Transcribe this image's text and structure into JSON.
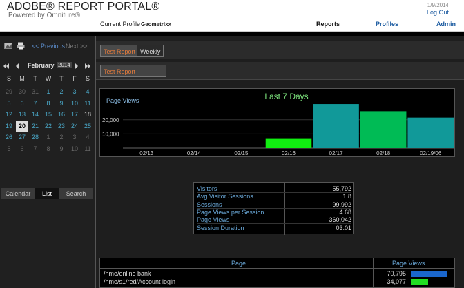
{
  "header": {
    "logo_title": "ADOBE® REPORT PORTAL®",
    "logo_subtitle": "Powered by Omniture®",
    "profile_label": "Current Profile",
    "profile_value": "Geometrixx",
    "date": "1/9/2014",
    "logout": "Log Out",
    "nav": [
      "Reports",
      "Profiles",
      "Admin"
    ]
  },
  "sidebar": {
    "prev": "<< Previous",
    "next": "Next >>",
    "month": "February",
    "year": "2014",
    "dow": [
      "S",
      "M",
      "T",
      "W",
      "T",
      "F",
      "S"
    ],
    "weeks": [
      [
        "29",
        "30",
        "31",
        "1",
        "2",
        "3",
        "4"
      ],
      [
        "5",
        "6",
        "7",
        "8",
        "9",
        "10",
        "11"
      ],
      [
        "12",
        "13",
        "14",
        "15",
        "16",
        "17",
        "18"
      ],
      [
        "19",
        "20",
        "21",
        "22",
        "23",
        "24",
        "25"
      ],
      [
        "26",
        "27",
        "28",
        "1",
        "2",
        "3",
        "4"
      ],
      [
        "5",
        "6",
        "7",
        "8",
        "9",
        "10",
        "11"
      ]
    ],
    "selected_day": "20",
    "tabs": [
      "Calendar",
      "List",
      "Search"
    ],
    "active_tab": "List"
  },
  "content": {
    "tabs": [
      "Test Report",
      "Weekly"
    ],
    "badge": "Test Report"
  },
  "chart_data": {
    "type": "bar",
    "title": "Last 7 Days",
    "ylabel": "Page Views",
    "categories": [
      "02/13",
      "02/14",
      "02/15",
      "02/16",
      "02/17",
      "02/18",
      "02/19/06"
    ],
    "values": [
      0,
      0,
      0,
      6500,
      31000,
      26000,
      21500
    ],
    "yticks": [
      "20,000",
      "10,000"
    ],
    "ylim": [
      0,
      32000
    ],
    "bar_colors": [
      "#00cc44",
      "#00cc44",
      "#00cc44",
      "#11ee11",
      "#119999",
      "#00bb55",
      "#119999"
    ]
  },
  "summary": {
    "rows": [
      {
        "label": "Visitors",
        "value": "55,792"
      },
      {
        "label": "Avg Visitor Sessions",
        "value": "1.8"
      },
      {
        "label": "Sessions",
        "value": "99,992"
      },
      {
        "label": "Page Views per Session",
        "value": "4.68"
      },
      {
        "label": "Page Views",
        "value": "360,042"
      },
      {
        "label": "Session Duration",
        "value": "03:01"
      }
    ]
  },
  "pages_table": {
    "headers": [
      "Page",
      "Page Views"
    ],
    "rows": [
      {
        "page": "/hme/online bank",
        "views": "70,795",
        "share": 1.0,
        "color": "#1a66cc"
      },
      {
        "page": "/hme/s1/red/Account login",
        "views": "34,077",
        "share": 0.48,
        "color": "#22dd22"
      }
    ]
  }
}
